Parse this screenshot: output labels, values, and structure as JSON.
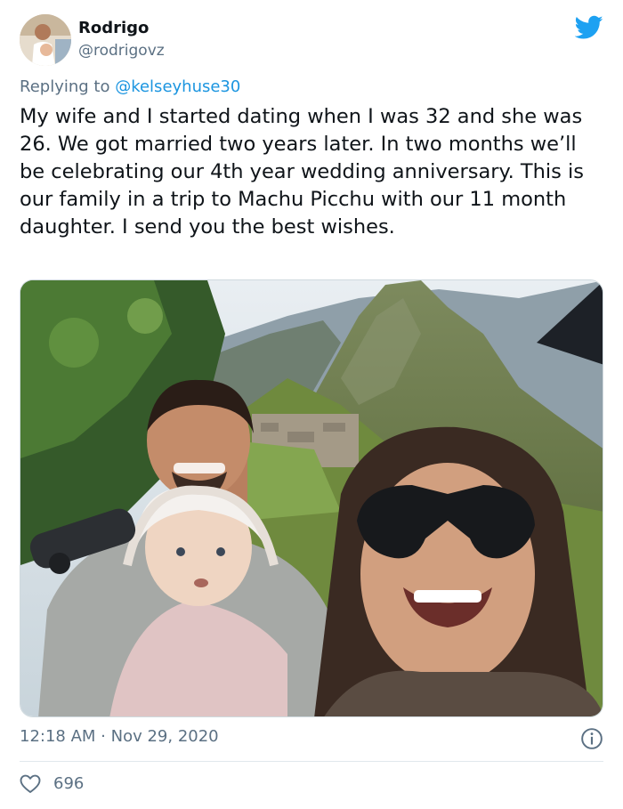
{
  "user": {
    "name": "Rodrigo",
    "handle": "@rodrigovz"
  },
  "reply": {
    "prefix": "Replying to ",
    "mention": "@kelseyhuse30"
  },
  "tweet": {
    "text": "My wife and I started dating when I was 32 and she was 26. We got married two years later. In two months we’ll be celebrating our 4th year wedding anniversary. This is our family in a trip to Machu Picchu with our 11 month daughter. I send you the best wishes."
  },
  "meta": {
    "time": "12:18 AM",
    "separator": " · ",
    "date": "Nov 29, 2020"
  },
  "engagement": {
    "likes": "696"
  },
  "icons": {
    "brand": "twitter-bird-icon",
    "info": "info-icon",
    "like": "heart-icon"
  },
  "colors": {
    "brand_blue": "#1da1f2",
    "secondary_text": "#5b7083",
    "mention": "#1b95e0"
  }
}
